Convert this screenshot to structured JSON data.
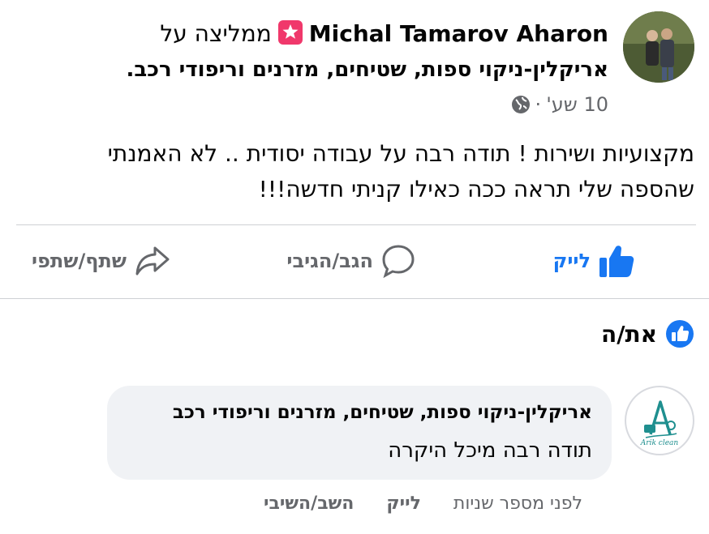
{
  "post": {
    "author_name": "Michal Tamarov Aharon",
    "recommends_text": "ממליצה על",
    "page_name": "אריקלין-ניקוי ספות, שטיחים, מזרנים וריפודי רכב.",
    "time": "10 שע'",
    "dot": "·",
    "body_line1": "מקצועיות ושירות ! תודה רבה על עבודה יסודית .. לא האמנתי",
    "body_line2": "שהספה שלי תראה ככה כאילו קניתי חדשה!!!"
  },
  "actions": {
    "like_label": "לייק",
    "comment_label": "הגב/הגיבי",
    "share_label": "שתף/שתפי"
  },
  "reactions": {
    "reactor_label": "את/ה"
  },
  "comment": {
    "author": "אריקלין-ניקוי ספות, שטיחים, מזרנים וריפודי רכב",
    "text": "תודה רבה מיכל היקרה",
    "time": "לפני מספר שניות",
    "like_label": "לייק",
    "reply_label": "השב/השיבי",
    "logo_text": "Arik clean"
  },
  "colors": {
    "accent": "#1877f2",
    "badge": "#f0386b",
    "muted": "#65676b",
    "bubble": "#f0f2f5"
  },
  "icons": {
    "recommend": "star-flag-icon",
    "globe": "globe-icon",
    "like": "thumbs-up-icon",
    "comment": "speech-bubble-icon",
    "share": "share-arrow-icon"
  }
}
